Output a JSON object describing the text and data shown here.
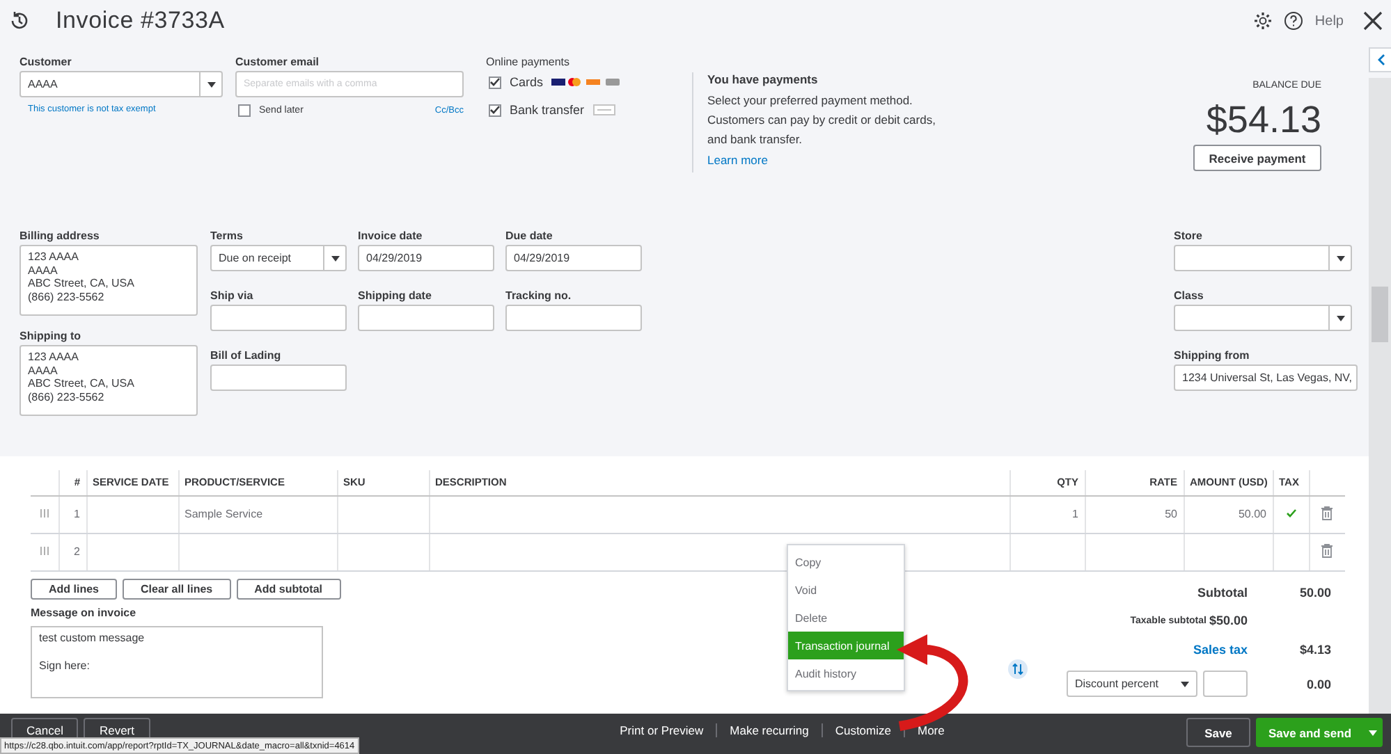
{
  "header": {
    "title": "Invoice #3733A",
    "help": "Help"
  },
  "customer": {
    "label": "Customer",
    "value": "AAAA",
    "note": "This customer is not tax exempt"
  },
  "email": {
    "label": "Customer email",
    "placeholder": "Separate emails with a comma",
    "send_later": {
      "label": "Send later",
      "checked": false
    },
    "cc_bcc": "Cc/Bcc"
  },
  "online_payments": {
    "label": "Online payments",
    "methods": [
      {
        "kind": "cards",
        "label": "Cards",
        "checked": true
      },
      {
        "kind": "bank",
        "label": "Bank transfer",
        "checked": true
      }
    ]
  },
  "payments_info": {
    "title": "You have payments",
    "lines": [
      "Select your preferred payment method.",
      "Customers can pay by credit or debit cards,",
      "and bank transfer."
    ],
    "link": "Learn more"
  },
  "balance": {
    "label": "BALANCE DUE",
    "amount": "$54.13",
    "button": "Receive payment"
  },
  "billing_address": {
    "label": "Billing address",
    "lines": [
      "123 AAAA",
      "AAAA",
      "ABC Street, CA, USA",
      "(866) 223-5562"
    ]
  },
  "shipping_to": {
    "label": "Shipping to",
    "lines": [
      "123 AAAA",
      "AAAA",
      "ABC Street, CA, USA",
      "(866) 223-5562"
    ]
  },
  "fields": [
    {
      "label": "Terms",
      "kind": "select",
      "value": "Due on receipt"
    },
    {
      "label": "Invoice date",
      "kind": "text",
      "value": "04/29/2019"
    },
    {
      "label": "Due date",
      "kind": "text",
      "value": "04/29/2019"
    },
    {
      "label": "Ship via",
      "kind": "text"
    },
    {
      "label": "Shipping date",
      "kind": "text"
    },
    {
      "label": "Tracking no.",
      "kind": "text"
    },
    {
      "label": "Bill of Lading",
      "kind": "text"
    }
  ],
  "side_fields": [
    {
      "label": "Store",
      "kind": "select"
    },
    {
      "label": "Class",
      "kind": "select"
    },
    {
      "label": "Shipping from",
      "kind": "text",
      "value": "1234 Universal St, Las Vegas, NV,"
    }
  ],
  "table": {
    "columns": [
      "#",
      "SERVICE DATE",
      "PRODUCT/SERVICE",
      "SKU",
      "DESCRIPTION",
      "QTY",
      "RATE",
      "AMOUNT (USD)",
      "TAX"
    ],
    "rows": [
      {
        "number": "1",
        "product": "Sample Service",
        "qty": "1",
        "rate": "50",
        "amount": "50.00",
        "taxable": true
      },
      {
        "number": "2",
        "taxable": false
      }
    ]
  },
  "line_buttons": [
    "Add lines",
    "Clear all lines",
    "Add subtotal"
  ],
  "message": {
    "label": "Message on invoice",
    "value": "test custom message\n\nSign here:"
  },
  "totals": {
    "subtotal": {
      "label": "Subtotal",
      "value": "50.00"
    },
    "taxable": {
      "label": "Taxable subtotal",
      "value": "$50.00"
    },
    "sales_tax": {
      "label": "Sales tax",
      "value": "$4.13"
    },
    "discount": {
      "select": "Discount percent",
      "value": "0.00"
    }
  },
  "more_menu": {
    "items": [
      {
        "label": "Copy",
        "selected": false
      },
      {
        "label": "Void",
        "selected": false
      },
      {
        "label": "Delete",
        "selected": false
      },
      {
        "label": "Transaction journal",
        "selected": true
      },
      {
        "label": "Audit history",
        "selected": false
      }
    ]
  },
  "footer": {
    "left": [
      "Cancel",
      "Revert"
    ],
    "center": [
      "Print or Preview",
      "Make recurring",
      "Customize",
      "More"
    ],
    "save": "Save",
    "save_send": "Save and send"
  },
  "status_url": "https://c28.qbo.intuit.com/app/report?rptId=TX_JOURNAL&date_macro=all&txnid=4614"
}
